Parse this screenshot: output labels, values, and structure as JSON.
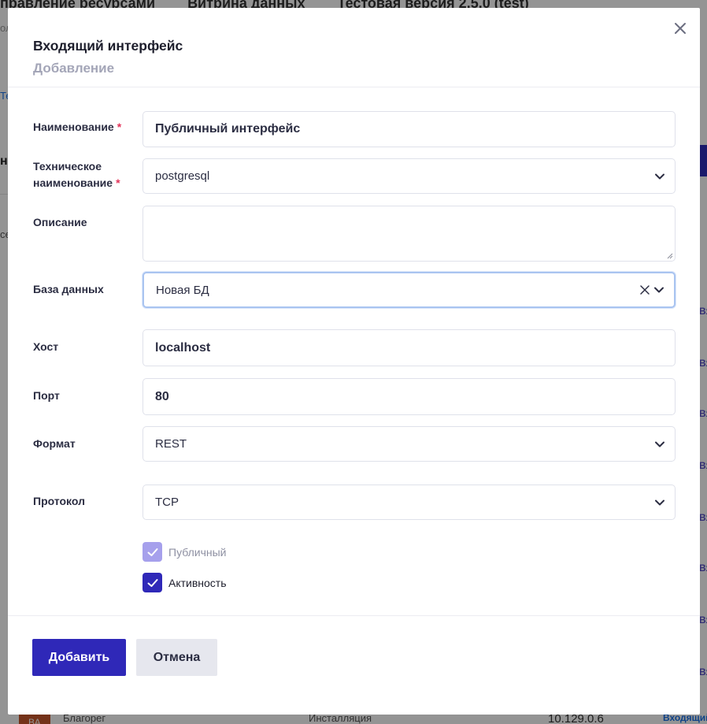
{
  "background": {
    "top_tabs": [
      "правление ресурсами",
      "Витрина данных",
      "Тестовая версия 2.5.0 (test)"
    ],
    "sub": "ол",
    "link": "Те",
    "bold": "н",
    "c_text": "се",
    "right_items": [
      "Входящий",
      "Входящий",
      "Входящий",
      "Входящий",
      "Входящий",
      "Входящий",
      "Входящий",
      "Входящий",
      "Входящий"
    ],
    "bottom_row": {
      "avatar": "ВА",
      "name": "Благорег",
      "status": "Инсталляция",
      "ip": "10.129.0.6",
      "type": "Входящий"
    }
  },
  "modal": {
    "title": "Входящий интерфейс",
    "subtitle": "Добавление",
    "close_icon": "close-icon",
    "fields": {
      "name": {
        "label": "Наименование",
        "required_mark": "*",
        "value": "Публичный интерфейс"
      },
      "tech_name": {
        "label_line1": "Техническое",
        "label_line2": "наименование",
        "required_mark": "*",
        "value": "postgresql"
      },
      "description": {
        "label": "Описание",
        "value": ""
      },
      "database": {
        "label": "База данных",
        "value": "Новая БД"
      },
      "host": {
        "label": "Хост",
        "value": "localhost"
      },
      "port": {
        "label": "Порт",
        "value": "80"
      },
      "format": {
        "label": "Формат",
        "value": "REST"
      },
      "protocol": {
        "label": "Протокол",
        "value": "TCP"
      }
    },
    "checkboxes": {
      "public": {
        "label": "Публичный",
        "checked": true,
        "disabled": true
      },
      "active": {
        "label": "Активность",
        "checked": true,
        "disabled": false
      }
    },
    "buttons": {
      "add": "Добавить",
      "cancel": "Отмена"
    }
  },
  "colors": {
    "primary": "#2f28b8",
    "primary_disabled": "#a6a0ec",
    "required": "#e3345a",
    "focus_border": "#a9c4f0",
    "secondary_button": "#e6e7ee"
  }
}
